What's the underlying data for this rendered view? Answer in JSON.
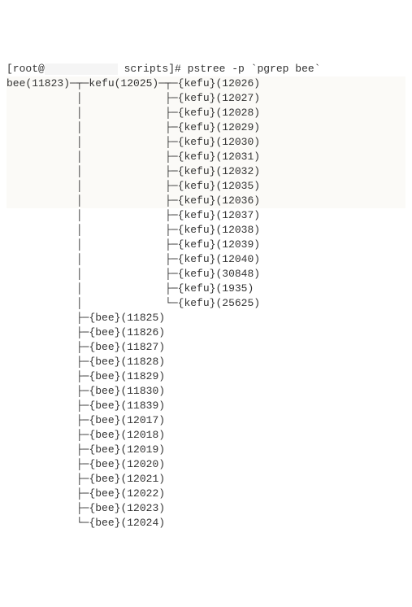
{
  "prompt": {
    "prefix": "[root@",
    "middle": " scripts]# ",
    "command": "pstree -p `pgrep bee`"
  },
  "tree": {
    "root_name": "bee",
    "root_pid": "11823",
    "kefu_parent_name": "kefu",
    "kefu_parent_pid": "12025",
    "kefu_threads": [
      {
        "name": "kefu",
        "pid": "12026"
      },
      {
        "name": "kefu",
        "pid": "12027"
      },
      {
        "name": "kefu",
        "pid": "12028"
      },
      {
        "name": "kefu",
        "pid": "12029"
      },
      {
        "name": "kefu",
        "pid": "12030"
      },
      {
        "name": "kefu",
        "pid": "12031"
      },
      {
        "name": "kefu",
        "pid": "12032"
      },
      {
        "name": "kefu",
        "pid": "12035"
      },
      {
        "name": "kefu",
        "pid": "12036"
      },
      {
        "name": "kefu",
        "pid": "12037"
      },
      {
        "name": "kefu",
        "pid": "12038"
      },
      {
        "name": "kefu",
        "pid": "12039"
      },
      {
        "name": "kefu",
        "pid": "12040"
      },
      {
        "name": "kefu",
        "pid": "30848"
      },
      {
        "name": "kefu",
        "pid": "1935"
      },
      {
        "name": "kefu",
        "pid": "25625"
      }
    ],
    "bee_threads": [
      {
        "name": "bee",
        "pid": "11825"
      },
      {
        "name": "bee",
        "pid": "11826"
      },
      {
        "name": "bee",
        "pid": "11827"
      },
      {
        "name": "bee",
        "pid": "11828"
      },
      {
        "name": "bee",
        "pid": "11829"
      },
      {
        "name": "bee",
        "pid": "11830"
      },
      {
        "name": "bee",
        "pid": "11839"
      },
      {
        "name": "bee",
        "pid": "12017"
      },
      {
        "name": "bee",
        "pid": "12018"
      },
      {
        "name": "bee",
        "pid": "12019"
      },
      {
        "name": "bee",
        "pid": "12020"
      },
      {
        "name": "bee",
        "pid": "12021"
      },
      {
        "name": "bee",
        "pid": "12022"
      },
      {
        "name": "bee",
        "pid": "12023"
      },
      {
        "name": "bee",
        "pid": "12024"
      }
    ]
  }
}
